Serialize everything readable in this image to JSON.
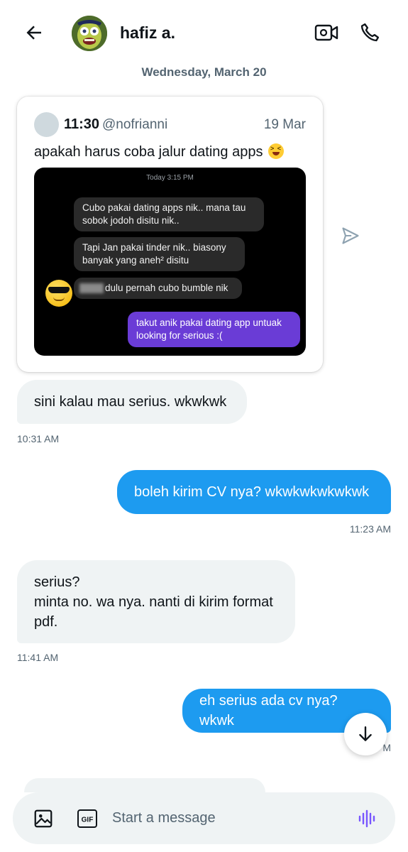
{
  "header": {
    "contact_name": "hafiz a."
  },
  "date_separator": "Wednesday, March 20",
  "shared_tweet": {
    "author": "11:30",
    "handle": "@nofrianni",
    "date": "19 Mar",
    "text": "apakah harus coba jalur dating apps",
    "media": {
      "time": "Today 3:15 PM",
      "bubble_1": "Cubo pakai dating apps nik.. mana tau sobok jodoh disitu nik..",
      "bubble_2": "Tapi Jan pakai tinder nik.. biasony banyak yang aneh² disitu",
      "bubble_3": "dulu pernah cubo bumble nik",
      "bubble_out": "takut anik pakai dating app untuak looking for serious :("
    }
  },
  "messages": [
    {
      "text": "sini kalau mau serius. wkwkwk",
      "time": "10:31 AM",
      "direction": "in"
    },
    {
      "text": "boleh kirim CV nya? wkwkwkwkwkwk",
      "time": "11:23 AM",
      "direction": "out"
    },
    {
      "text": "serius?\nminta no. wa nya. nanti di kirim format pdf.",
      "time": "11:41 AM",
      "direction": "in"
    },
    {
      "text": "eh serius ada cv nya? wkwk",
      "time": "M",
      "direction": "out"
    }
  ],
  "composer": {
    "placeholder": "Start a message",
    "gif_label": "GIF"
  },
  "colors": {
    "accent": "#1d9bf0",
    "incoming_bubble": "#eff3f4",
    "voice": "#7856ff"
  }
}
